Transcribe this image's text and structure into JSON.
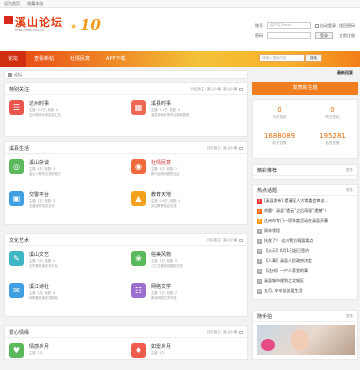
{
  "topbar": {
    "left": "设为首页",
    "right": "收藏本站"
  },
  "logo": {
    "title": "溪山论坛",
    "url": "http://bbs.xsu.cn",
    "deco": "10"
  },
  "login": {
    "user_label": "账号",
    "user_placeholder": "用户名/Email",
    "auto_login": "自动登录",
    "forgot": "找回密码",
    "pass_label": "密码",
    "login_button": "登录",
    "register": "立即注册"
  },
  "nav": {
    "items": [
      "论坛",
      "查看新帖",
      "社情民意",
      "APP下载"
    ]
  },
  "search": {
    "placeholder": "请输入搜索内容",
    "button": "搜索"
  },
  "newest_label": "最新回复",
  "breadcrumb": {
    "text": "论坛"
  },
  "categories": [
    {
      "title": "特别关注",
      "meta": "分区版主: 溪山小编, 溪山小编",
      "forums": [
        {
          "name": "达州时事",
          "stat": "主题: 3.1万, 帖数: 8",
          "desc": "达州新闻头条信息汇总",
          "color": "#e9564d",
          "icon": "☰"
        },
        {
          "name": "溪县时事",
          "stat": "主题: 1.1万, 帖数: 9",
          "desc": "溪县本地时事热点新闻报道",
          "color": "#ec6a55",
          "icon": "▦"
        }
      ]
    },
    {
      "title": "溪县生活",
      "meta": "分区版主: 溪山小编",
      "forums": [
        {
          "name": "溪山杂谈",
          "stat": "主题: 4万, 帖数: 3",
          "desc": "溪山人聊天交流的地方",
          "color": "#5bb85d",
          "icon": "◎"
        },
        {
          "name": "社情民意",
          "stat": "主题: 1万, 帖数: 2",
          "desc": "群众反映问题的社区",
          "color": "#ef6a3d",
          "icon": "◉"
        },
        {
          "name": "交警平台",
          "stat": "主题: 1万, 帖数: 3",
          "desc": "交通违章信息交流",
          "color": "#3f9fe0",
          "icon": "▣"
        },
        {
          "name": "教育天地",
          "stat": "主题: 0.6万, 帖数: 4",
          "desc": "关注教育信息交流",
          "color": "#f2a21e",
          "icon": "▲"
        }
      ]
    },
    {
      "title": "文化艺术",
      "meta": "分区版主: 溪山小编",
      "forums": [
        {
          "name": "溪山文艺",
          "stat": "主题: 2万, 帖数: 5",
          "desc": "文学爱好者交流平台",
          "color": "#3fb6c4",
          "icon": "✎"
        },
        {
          "name": "俗美风物",
          "stat": "主题: 1万, 帖数: 5",
          "desc": "三汇古镇风景摄影交流",
          "color": "#5cb85c",
          "icon": "❀"
        },
        {
          "name": "溪江诗社",
          "stat": "主题: 1万, 帖数: 6",
          "desc": "诗歌爱好者交流园地",
          "color": "#3f9fe0",
          "icon": "✉"
        },
        {
          "name": "网络文学",
          "stat": "主题: 1万, 帖数: 2",
          "desc": "原创网络文学作品",
          "color": "#9b6fcf",
          "icon": "☷"
        }
      ]
    },
    {
      "title": "爱心情缘",
      "meta": "分区版主: 溪山小编",
      "forums": [
        {
          "name": "情感乡月",
          "stat": "主题: 1万",
          "desc": "",
          "color": "#5bb85d",
          "icon": "♥"
        },
        {
          "name": "如雷乡月",
          "stat": "主题: 1万",
          "desc": "",
          "color": "#ef5b4d",
          "icon": "♦"
        }
      ]
    }
  ],
  "sidebar": {
    "post_button": "发表新主题",
    "stats": [
      {
        "num": "0",
        "label": "今日发帖"
      },
      {
        "num": "0",
        "label": "昨日发帖"
      },
      {
        "num": "1688089",
        "label": "帖子总数"
      },
      {
        "num": "195281",
        "label": "会员总数"
      }
    ],
    "featured": {
      "title": "精彩推荐",
      "more": "更多"
    },
    "hot": {
      "title": "热点话题",
      "more": "更多",
      "items": [
        "[溪县发布] 提请区人大常委会审议...",
        "命题！溪县“遗云”之后再现“遗憾”！",
        "达州市专门一项年度活动在溪县开幕",
        "周末领悟",
        "扶贫了？ 达川警方捣毁窝点",
        "【公示】6月1日起已签约",
        "【人事】溪县人民政府决定",
        "【达州】一户人家里的事",
        "溪县城市规划之北城区",
        "五月, 辛辛苦苦爱生活"
      ]
    },
    "photos": {
      "title": "随手拍",
      "more": "更多"
    }
  }
}
